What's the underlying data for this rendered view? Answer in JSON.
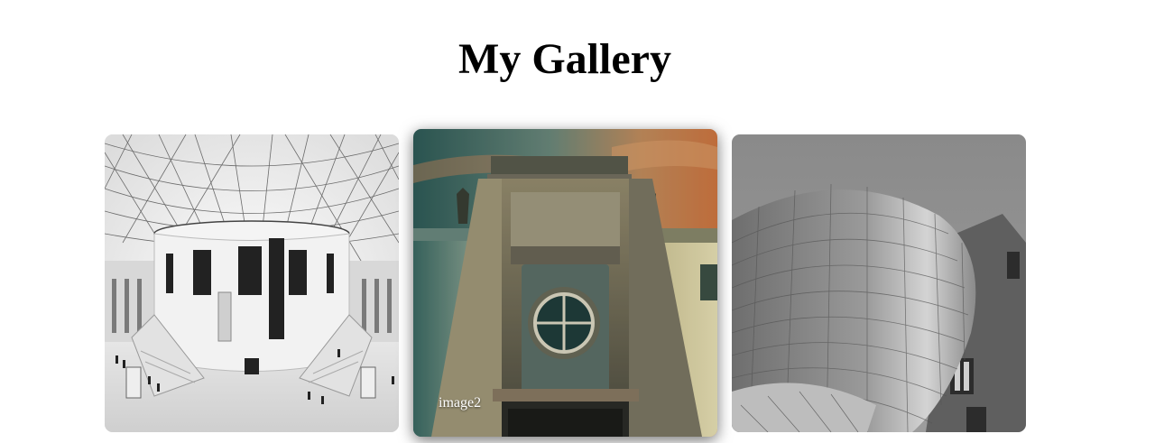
{
  "page": {
    "title": "My Gallery"
  },
  "gallery": {
    "items": [
      {
        "caption": "",
        "subject": "museum-atrium-photo"
      },
      {
        "caption": "image2",
        "subject": "building-facade-photo"
      },
      {
        "caption": "",
        "subject": "curved-architecture-photo"
      }
    ]
  }
}
